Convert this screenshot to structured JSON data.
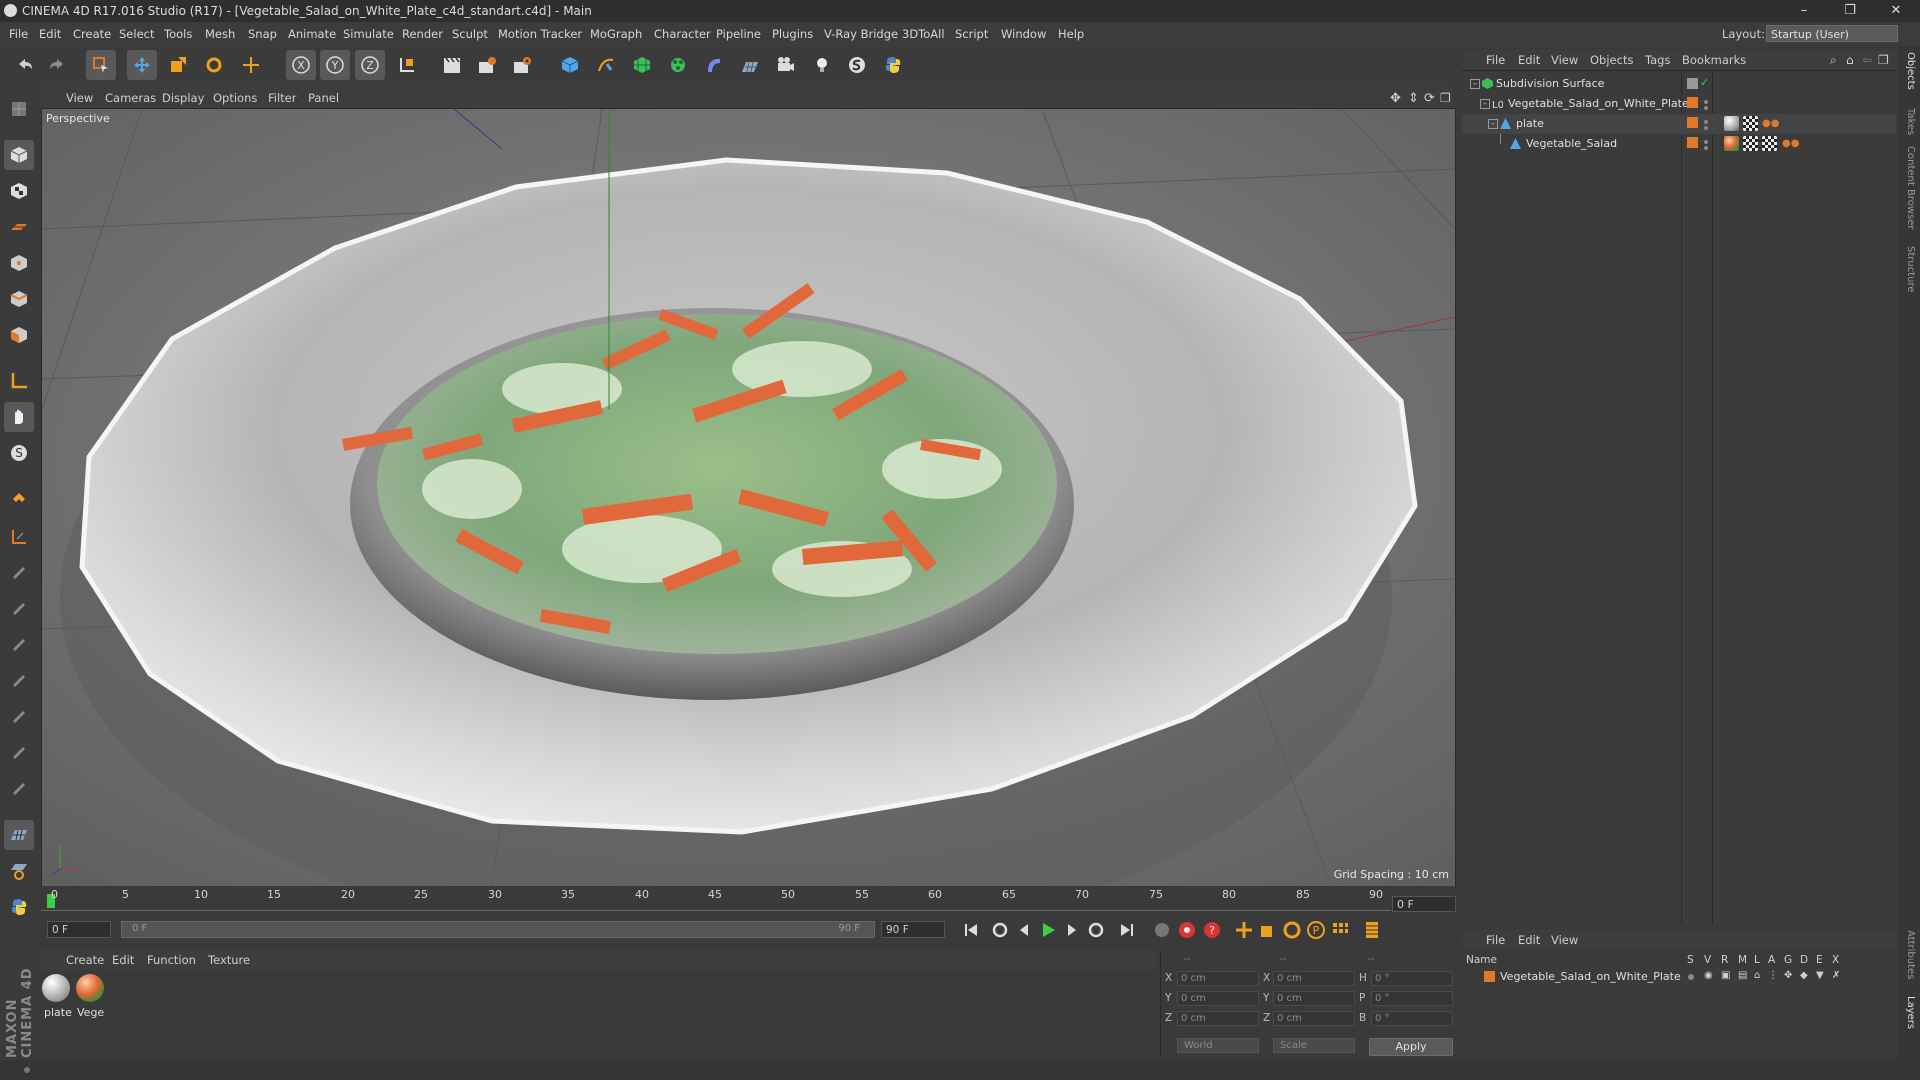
{
  "window": {
    "title": "CINEMA 4D R17.016 Studio (R17) - [Vegetable_Salad_on_White_Plate_c4d_standart.c4d] - Main",
    "controls": [
      "–",
      "❐",
      "✕"
    ]
  },
  "menubar": {
    "items": [
      "File",
      "Edit",
      "Create",
      "Select",
      "Tools",
      "Mesh",
      "Snap",
      "Animate",
      "Simulate",
      "Render",
      "Sculpt",
      "Motion Tracker",
      "MoGraph",
      "Character",
      "Pipeline",
      "Plugins",
      "V-Ray Bridge",
      "3DToAll",
      "Script",
      "Window",
      "Help"
    ],
    "layout_label": "Layout:",
    "layout_value": "Startup (User)"
  },
  "viewport": {
    "menu": [
      "View",
      "Cameras",
      "Display",
      "Options",
      "Filter",
      "Panel"
    ],
    "camera": "Perspective",
    "grid_spacing": "Grid Spacing : 10 cm"
  },
  "timeline": {
    "ticks": [
      "0",
      "5",
      "10",
      "15",
      "20",
      "25",
      "30",
      "35",
      "40",
      "45",
      "50",
      "55",
      "60",
      "65",
      "70",
      "75",
      "80",
      "85",
      "90"
    ],
    "current_frame": "0 F",
    "start_field": "0 F",
    "range_start": "0 F",
    "range_end": "90 F",
    "end_field": "90 F"
  },
  "material_manager": {
    "menu": [
      "Create",
      "Edit",
      "Function",
      "Texture"
    ],
    "materials": [
      {
        "name": "plate"
      },
      {
        "name": "Vege"
      }
    ]
  },
  "coordinates": {
    "header": [
      "--",
      "--",
      "--"
    ],
    "rows": [
      {
        "a": "X",
        "av": "0 cm",
        "b": "X",
        "bv": "0 cm",
        "c": "H",
        "cv": "0 °"
      },
      {
        "a": "Y",
        "av": "0 cm",
        "b": "Y",
        "bv": "0 cm",
        "c": "P",
        "cv": "0 °"
      },
      {
        "a": "Z",
        "av": "0 cm",
        "b": "Z",
        "bv": "0 cm",
        "c": "B",
        "cv": "0 °"
      }
    ],
    "mode": "World",
    "scale": "Scale",
    "apply": "Apply"
  },
  "object_manager": {
    "menu": [
      "File",
      "Edit",
      "View",
      "Objects",
      "Tags",
      "Bookmarks"
    ],
    "objects": [
      {
        "name": "Subdivision Surface"
      },
      {
        "name": "Vegetable_Salad_on_White_Plate"
      },
      {
        "name": "plate"
      },
      {
        "name": "Vegetable_Salad"
      }
    ]
  },
  "layer_manager": {
    "menu": [
      "File",
      "Edit",
      "View"
    ],
    "columns": [
      "Name",
      "S",
      "V",
      "R",
      "M",
      "L",
      "A",
      "G",
      "D",
      "E",
      "X"
    ],
    "row": "Vegetable_Salad_on_White_Plate"
  },
  "side_tabs": [
    "Objects",
    "Takes",
    "Content Browser",
    "Structure",
    "Attributes",
    "Layers"
  ],
  "brand": "MAXON CINEMA 4D",
  "colors": {
    "accent": "#e07a2a",
    "viewport_bg": "#6e6e6e"
  }
}
